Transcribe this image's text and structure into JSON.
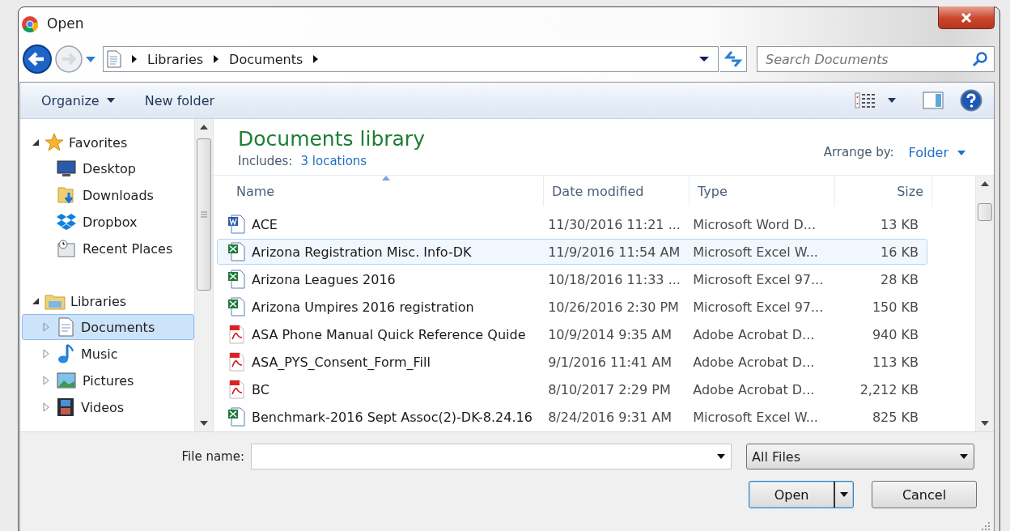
{
  "window": {
    "title": "Open"
  },
  "address": {
    "crumbs": [
      "Libraries",
      "Documents"
    ]
  },
  "search": {
    "placeholder": "Search Documents"
  },
  "toolbar": [
    {
      "label": "Organize",
      "kind": "menu"
    },
    {
      "label": "New folder",
      "kind": "button"
    }
  ],
  "sidebar": [
    {
      "label": "Favorites",
      "expanded": true,
      "kind": "star",
      "items": [
        {
          "label": "Desktop",
          "kind": "desktop",
          "selected": false
        },
        {
          "label": "Downloads",
          "kind": "downloads",
          "selected": false
        },
        {
          "label": "Dropbox",
          "kind": "dropbox",
          "selected": false
        },
        {
          "label": "Recent Places",
          "kind": "recent",
          "selected": false
        }
      ]
    },
    {
      "label": "Libraries",
      "expanded": true,
      "kind": "library",
      "items": [
        {
          "label": "Documents",
          "kind": "documents",
          "selected": true,
          "expanded": false
        },
        {
          "label": "Music",
          "kind": "music",
          "selected": false,
          "expanded": false
        },
        {
          "label": "Pictures",
          "kind": "pictures",
          "selected": false,
          "expanded": false
        },
        {
          "label": "Videos",
          "kind": "videos",
          "selected": false,
          "expanded": false
        }
      ]
    }
  ],
  "library": {
    "title": "Documents library",
    "includes_label": "Includes:",
    "includes_link": "3 locations",
    "arrange_label": "Arrange by:",
    "arrange_value": "Folder"
  },
  "table": {
    "columns": [
      {
        "label": "Name",
        "sorted": true
      },
      {
        "label": "Date modified",
        "sorted": false
      },
      {
        "label": "Type",
        "sorted": false
      },
      {
        "label": "Size",
        "sorted": false
      }
    ],
    "rows": [
      {
        "name": "ACE",
        "date": "11/30/2016 11:21 ...",
        "type": "Microsoft Word D...",
        "size": "13 KB",
        "kind": "word",
        "selected": false
      },
      {
        "name": "Arizona  Registration Misc. Info-DK",
        "date": "11/9/2016 11:54 AM",
        "type": "Microsoft Excel W...",
        "size": "16 KB",
        "kind": "excel",
        "selected": true
      },
      {
        "name": "Arizona Leagues 2016",
        "date": "10/18/2016 11:33 ...",
        "type": "Microsoft Excel 97...",
        "size": "28 KB",
        "kind": "excel",
        "selected": false
      },
      {
        "name": "Arizona Umpires 2016 registration",
        "date": "10/26/2016 2:30 PM",
        "type": "Microsoft Excel 97...",
        "size": "150 KB",
        "kind": "excel",
        "selected": false
      },
      {
        "name": "ASA Phone Manual Quick Reference Quide",
        "date": "10/9/2014 9:35 AM",
        "type": "Adobe Acrobat D...",
        "size": "940 KB",
        "kind": "pdf",
        "selected": false
      },
      {
        "name": "ASA_PYS_Consent_Form_Fill",
        "date": "9/1/2016 11:41 AM",
        "type": "Adobe Acrobat D...",
        "size": "113 KB",
        "kind": "pdf",
        "selected": false
      },
      {
        "name": "BC",
        "date": "8/10/2017 2:29 PM",
        "type": "Adobe Acrobat D...",
        "size": "2,212 KB",
        "kind": "pdf",
        "selected": false
      },
      {
        "name": "Benchmark-2016 Sept Assoc(2)-DK-8.24.16",
        "date": "8/24/2016 9:31 AM",
        "type": "Microsoft Excel W...",
        "size": "825 KB",
        "kind": "excel",
        "selected": false
      }
    ]
  },
  "file_name": {
    "label": "File name:"
  },
  "filter": {
    "value": "All Files"
  },
  "buttons": [
    {
      "label": "Open",
      "kind": "split",
      "default": true
    },
    {
      "label": "Cancel",
      "kind": "plain",
      "default": false
    }
  ]
}
